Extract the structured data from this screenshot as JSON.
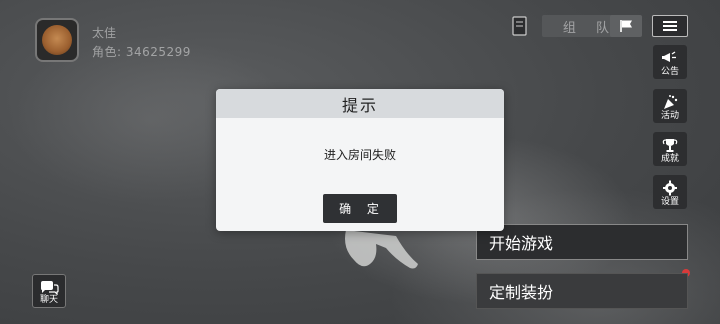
{
  "player": {
    "name": "太佳",
    "id_text": "角色: 34625299"
  },
  "topbar": {
    "team_label": "组 队"
  },
  "side_menu": [
    {
      "label": "公告",
      "icon": "megaphone-icon"
    },
    {
      "label": "活动",
      "icon": "party-popper-icon"
    },
    {
      "label": "成就",
      "icon": "trophy-icon"
    },
    {
      "label": "设置",
      "icon": "gear-icon"
    }
  ],
  "actions": {
    "start_game": "开始游戏",
    "customize": "定制装扮"
  },
  "chat": {
    "label": "聊天"
  },
  "dialog": {
    "title": "提示",
    "message": "进入房间失败",
    "confirm": "确 定"
  },
  "colors": {
    "notification_dot": "#d83a3a",
    "dialog_header": "#d7dadd",
    "dialog_button": "#2f3134"
  }
}
